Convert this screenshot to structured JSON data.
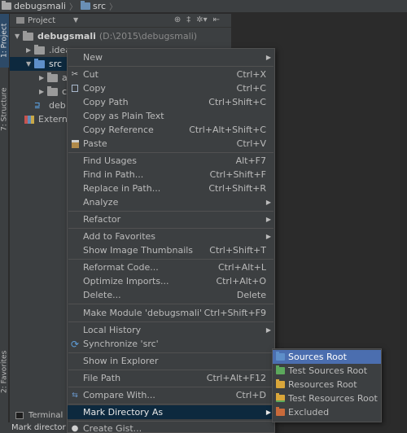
{
  "navbar": {
    "project": "debugsmali",
    "dir": "src"
  },
  "left_strip": {
    "project_tab": "1: Project",
    "structure_tab": "7: Structure",
    "favorites_tab": "2: Favorites"
  },
  "panel": {
    "title": "Project",
    "tree": {
      "root_name": "debugsmali",
      "root_path": "(D:\\2015\\debugsmali)",
      "idea": ".idea",
      "src": "src",
      "child_a": "a",
      "child_c": "c",
      "iml": "deb",
      "ext": "Externa"
    }
  },
  "bottom": {
    "terminal_tab": "Terminal",
    "status_text": "Mark director"
  },
  "menu": {
    "new": "New",
    "cut": {
      "label": "Cut",
      "shortcut": "Ctrl+X"
    },
    "copy": {
      "label": "Copy",
      "shortcut": "Ctrl+C"
    },
    "copy_path": {
      "label": "Copy Path",
      "shortcut": "Ctrl+Shift+C"
    },
    "copy_plain": {
      "label": "Copy as Plain Text"
    },
    "copy_ref": {
      "label": "Copy Reference",
      "shortcut": "Ctrl+Alt+Shift+C"
    },
    "paste": {
      "label": "Paste",
      "shortcut": "Ctrl+V"
    },
    "find_usages": {
      "label": "Find Usages",
      "shortcut": "Alt+F7"
    },
    "find_in_path": {
      "label": "Find in Path...",
      "shortcut": "Ctrl+Shift+F"
    },
    "replace_in_path": {
      "label": "Replace in Path...",
      "shortcut": "Ctrl+Shift+R"
    },
    "analyze": "Analyze",
    "refactor": "Refactor",
    "add_favorites": "Add to Favorites",
    "show_thumbs": {
      "label": "Show Image Thumbnails",
      "shortcut": "Ctrl+Shift+T"
    },
    "reformat": {
      "label": "Reformat Code...",
      "shortcut": "Ctrl+Alt+L"
    },
    "optimize": {
      "label": "Optimize Imports...",
      "shortcut": "Ctrl+Alt+O"
    },
    "delete": {
      "label": "Delete...",
      "shortcut": "Delete"
    },
    "make_module": {
      "label": "Make Module 'debugsmali'",
      "shortcut": "Ctrl+Shift+F9"
    },
    "local_history": "Local History",
    "synchronize": "Synchronize 'src'",
    "show_explorer": "Show in Explorer",
    "file_path": {
      "label": "File Path",
      "shortcut": "Ctrl+Alt+F12"
    },
    "compare": {
      "label": "Compare With...",
      "shortcut": "Ctrl+D"
    },
    "mark_dir": "Mark Directory As",
    "create_gist": "Create Gist..."
  },
  "submenu": {
    "sources_root": "Sources Root",
    "test_sources_root": "Test Sources Root",
    "resources_root": "Resources Root",
    "test_resources_root": "Test Resources Root",
    "excluded": "Excluded"
  },
  "colors": {
    "highlight": "#0d293e",
    "submenu_highlight": "#4b6eaf",
    "sources_folder": "#5e8fc9",
    "test_sources_folder": "#5ca85c",
    "resources_folder": "#d9a63a",
    "excluded_folder": "#c96a3a"
  }
}
